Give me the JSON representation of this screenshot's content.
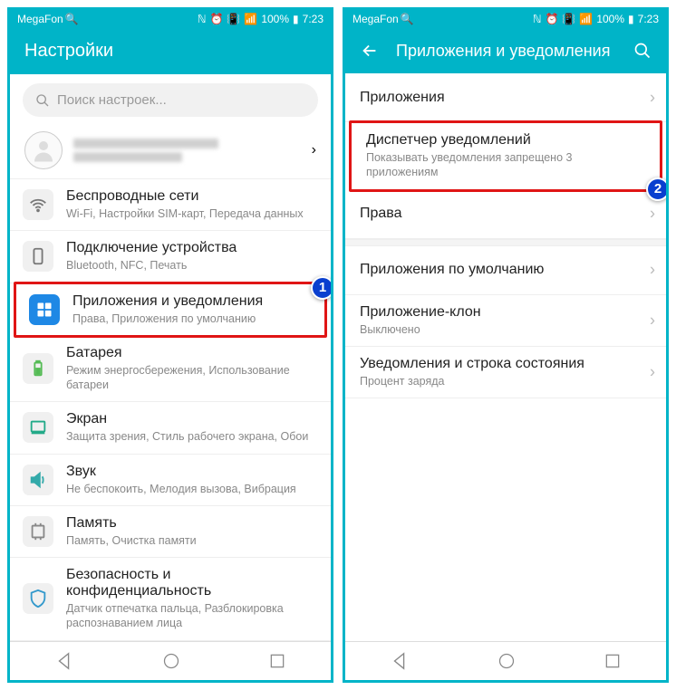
{
  "statusbar": {
    "carrier": "MegaFon",
    "battery": "100%",
    "time": "7:23"
  },
  "left": {
    "header": {
      "title": "Настройки"
    },
    "search": {
      "placeholder": "Поиск настроек..."
    },
    "items": [
      {
        "key": "wifi",
        "title": "Беспроводные сети",
        "sub": "Wi-Fi, Настройки SIM-карт, Передача данных"
      },
      {
        "key": "devices",
        "title": "Подключение устройства",
        "sub": "Bluetooth, NFC, Печать"
      },
      {
        "key": "apps",
        "title": "Приложения и уведомления",
        "sub": "Права, Приложения по умолчанию"
      },
      {
        "key": "battery",
        "title": "Батарея",
        "sub": "Режим энергосбережения, Использование батареи"
      },
      {
        "key": "display",
        "title": "Экран",
        "sub": "Защита зрения, Стиль рабочего экрана, Обои"
      },
      {
        "key": "sound",
        "title": "Звук",
        "sub": "Не беспокоить, Мелодия вызова, Вибрация"
      },
      {
        "key": "memory",
        "title": "Память",
        "sub": "Память, Очистка памяти"
      },
      {
        "key": "security",
        "title": "Безопасность и конфиденциальность",
        "sub": "Датчик отпечатка пальца, Разблокировка распознаванием лица"
      }
    ],
    "badge": "1"
  },
  "right": {
    "header": {
      "title": "Приложения и уведомления"
    },
    "items": [
      {
        "key": "apps",
        "title": "Приложения",
        "sub": ""
      },
      {
        "key": "notif",
        "title": "Диспетчер уведомлений",
        "sub": "Показывать уведомления запрещено 3 приложениям"
      },
      {
        "key": "perms",
        "title": "Права",
        "sub": ""
      },
      {
        "key": "default",
        "title": "Приложения по умолчанию",
        "sub": ""
      },
      {
        "key": "clone",
        "title": "Приложение-клон",
        "sub": "Выключено"
      },
      {
        "key": "statusbar",
        "title": "Уведомления и строка состояния",
        "sub": "Процент заряда"
      }
    ],
    "badge": "2"
  }
}
